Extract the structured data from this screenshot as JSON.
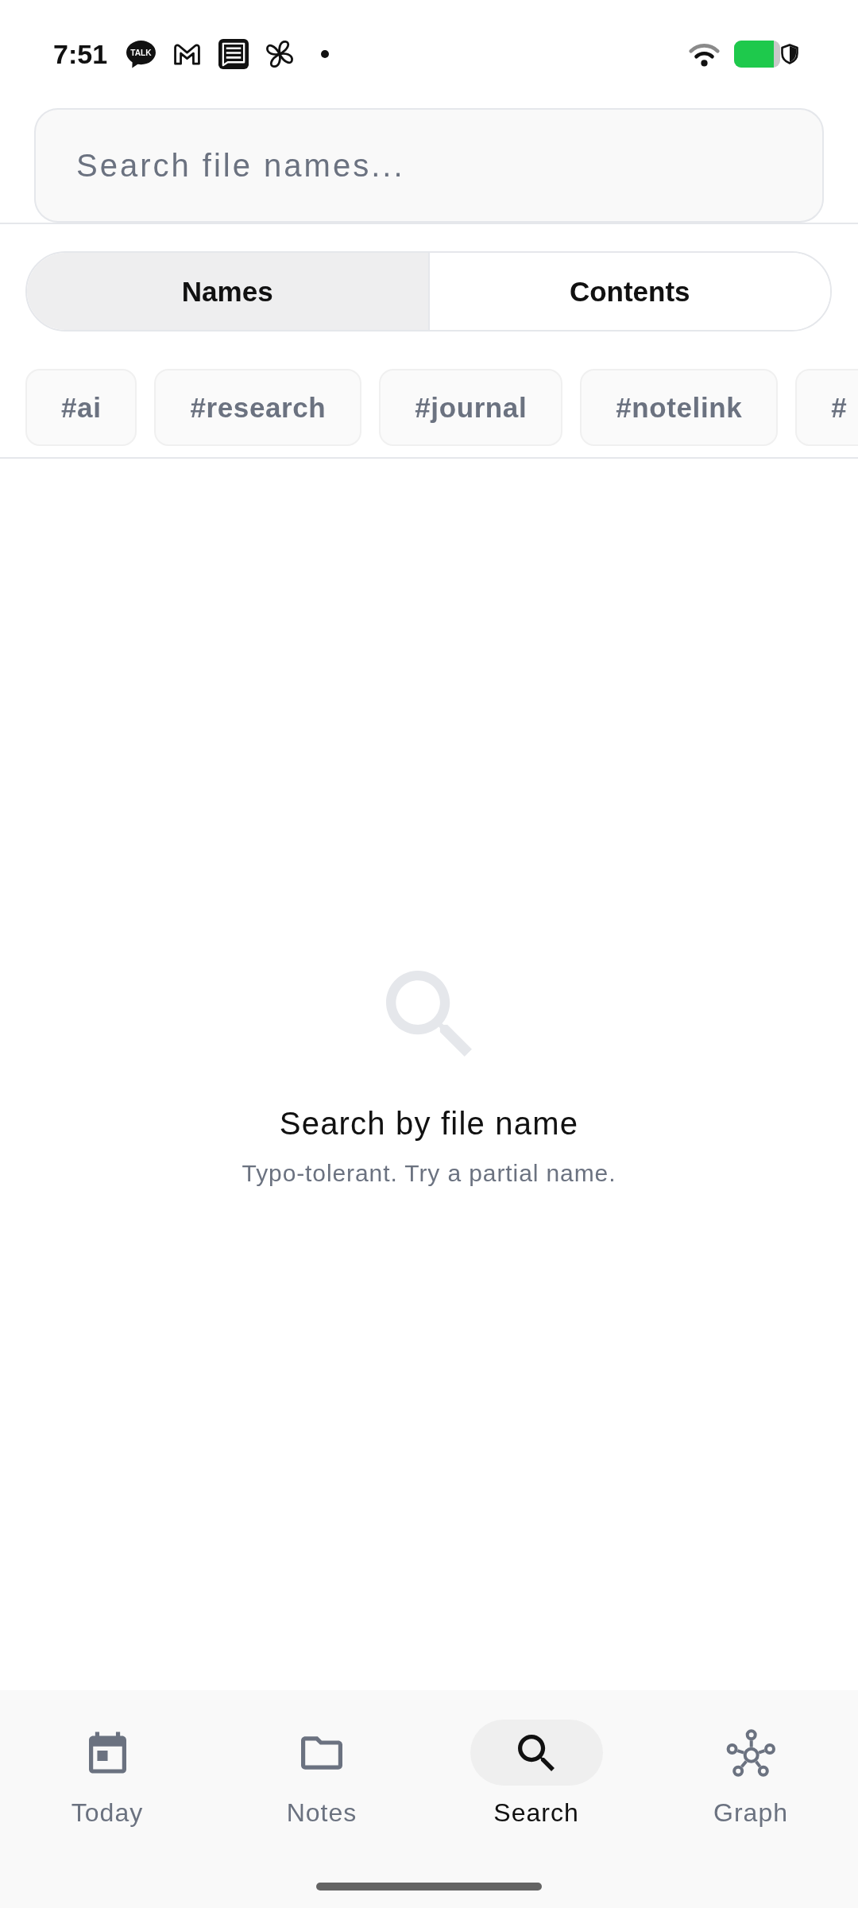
{
  "status_bar": {
    "time": "7:51",
    "chat_app_badge": "TALK"
  },
  "search": {
    "placeholder": "Search file names..."
  },
  "mode_tabs": [
    {
      "label": "Names",
      "selected": true
    },
    {
      "label": "Contents",
      "selected": false
    }
  ],
  "tags": [
    "#ai",
    "#research",
    "#journal",
    "#notelink",
    "#"
  ],
  "empty_state": {
    "title": "Search by file name",
    "subtitle": "Typo-tolerant. Try a partial name."
  },
  "bottom_nav": [
    {
      "label": "Today",
      "selected": false
    },
    {
      "label": "Notes",
      "selected": false
    },
    {
      "label": "Search",
      "selected": true
    },
    {
      "label": "Graph",
      "selected": false
    }
  ]
}
